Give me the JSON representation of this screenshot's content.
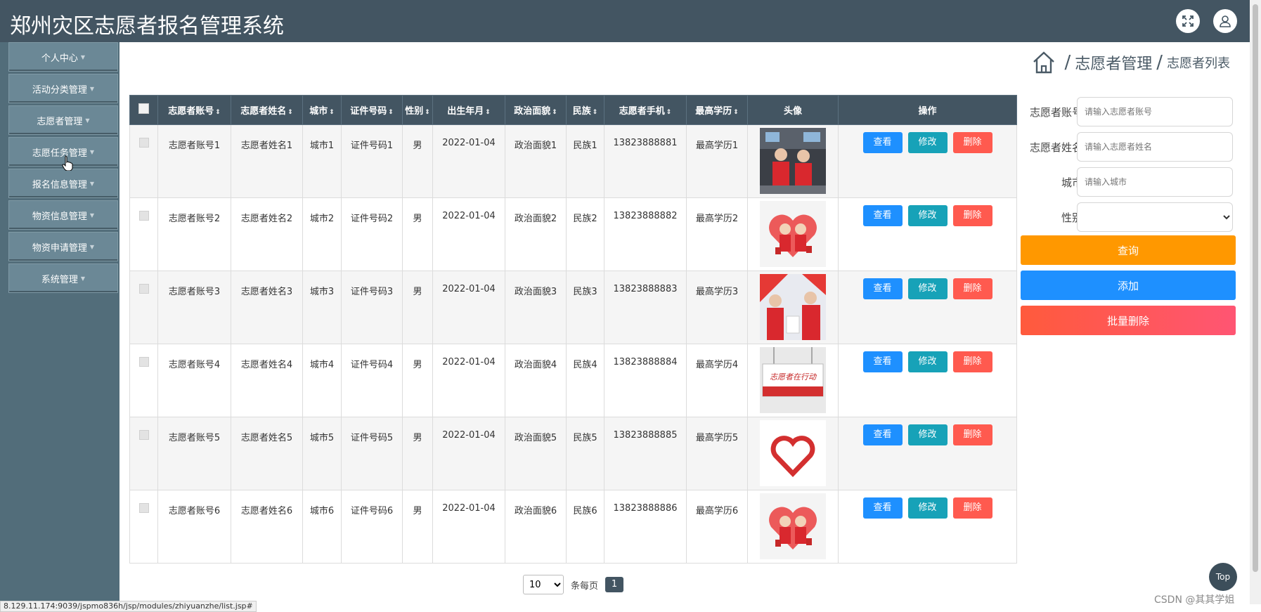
{
  "header": {
    "title": "郑州灾区志愿者报名管理系统"
  },
  "sidebar": {
    "items": [
      {
        "label": "个人中心"
      },
      {
        "label": "活动分类管理"
      },
      {
        "label": "志愿者管理"
      },
      {
        "label": "志愿任务管理"
      },
      {
        "label": "报名信息管理"
      },
      {
        "label": "物资信息管理"
      },
      {
        "label": "物资申请管理"
      },
      {
        "label": "系统管理"
      }
    ]
  },
  "breadcrumb": {
    "level1": "志愿者管理",
    "level2": "志愿者列表",
    "sep": "/"
  },
  "table": {
    "headers": [
      "志愿者账号",
      "志愿者姓名",
      "城市",
      "证件号码",
      "性别",
      "出生年月",
      "政治面貌",
      "民族",
      "志愿者手机",
      "最高学历",
      "头像",
      "操作"
    ],
    "rows": [
      {
        "account": "志愿者账号1",
        "name": "志愿者姓名1",
        "city": "城市1",
        "id_no": "证件号码1",
        "gender": "男",
        "birth": "2022-01-04",
        "political": "政治面貌1",
        "ethnic": "民族1",
        "phone": "13823888881",
        "education": "最高学历1",
        "avatar": "photo-volunteers-indoor"
      },
      {
        "account": "志愿者账号2",
        "name": "志愿者姓名2",
        "city": "城市2",
        "id_no": "证件号码2",
        "gender": "男",
        "birth": "2022-01-04",
        "political": "政治面貌2",
        "ethnic": "民族2",
        "phone": "13823888882",
        "education": "最高学历2",
        "avatar": "cartoon-volunteers-heart"
      },
      {
        "account": "志愿者账号3",
        "name": "志愿者姓名3",
        "city": "城市3",
        "id_no": "证件号码3",
        "gender": "男",
        "birth": "2022-01-04",
        "political": "政治面貌3",
        "ethnic": "民族3",
        "phone": "13823888883",
        "education": "最高学历3",
        "avatar": "photo-volunteers-red-vests"
      },
      {
        "account": "志愿者账号4",
        "name": "志愿者姓名4",
        "city": "城市4",
        "id_no": "证件号码4",
        "gender": "男",
        "birth": "2022-01-04",
        "political": "政治面貌4",
        "ethnic": "民族4",
        "phone": "13823888884",
        "education": "最高学历4",
        "avatar": "banner-volunteer-sign"
      },
      {
        "account": "志愿者账号5",
        "name": "志愿者姓名5",
        "city": "城市5",
        "id_no": "证件号码5",
        "gender": "男",
        "birth": "2022-01-04",
        "political": "政治面貌5",
        "ethnic": "民族5",
        "phone": "13823888885",
        "education": "最高学历5",
        "avatar": "red-heart-hand-logo"
      },
      {
        "account": "志愿者账号6",
        "name": "志愿者姓名6",
        "city": "城市6",
        "id_no": "证件号码6",
        "gender": "男",
        "birth": "2022-01-04",
        "political": "政治面貌6",
        "ethnic": "民族6",
        "phone": "13823888886",
        "education": "最高学历6",
        "avatar": "cartoon-volunteers-heart"
      }
    ],
    "actions": {
      "view": "查看",
      "edit": "修改",
      "delete": "删除"
    }
  },
  "search": {
    "account_label": "志愿者账号",
    "account_placeholder": "请输入志愿者账号",
    "name_label": "志愿者姓名",
    "name_placeholder": "请输入志愿者姓名",
    "city_label": "城市",
    "city_placeholder": "请输入城市",
    "gender_label": "性别",
    "gender_value": "",
    "query_btn": "查询",
    "add_btn": "添加",
    "batch_delete_btn": "批量删除"
  },
  "pager": {
    "page_size": "10",
    "per_page_label": "条每页",
    "current_page": "1"
  },
  "top_button": "Top",
  "status_url": "8.129.11.174:9039/jspmo836h/jsp/modules/zhiyuanzhe/list.jsp#",
  "watermark": "CSDN @其其学姐",
  "colors": {
    "header": "#435562",
    "sidebar": "#526d7a",
    "view": "#1e90ff",
    "edit": "#17a2b8",
    "delete": "#ff5a4f",
    "query": "#ff9800"
  }
}
